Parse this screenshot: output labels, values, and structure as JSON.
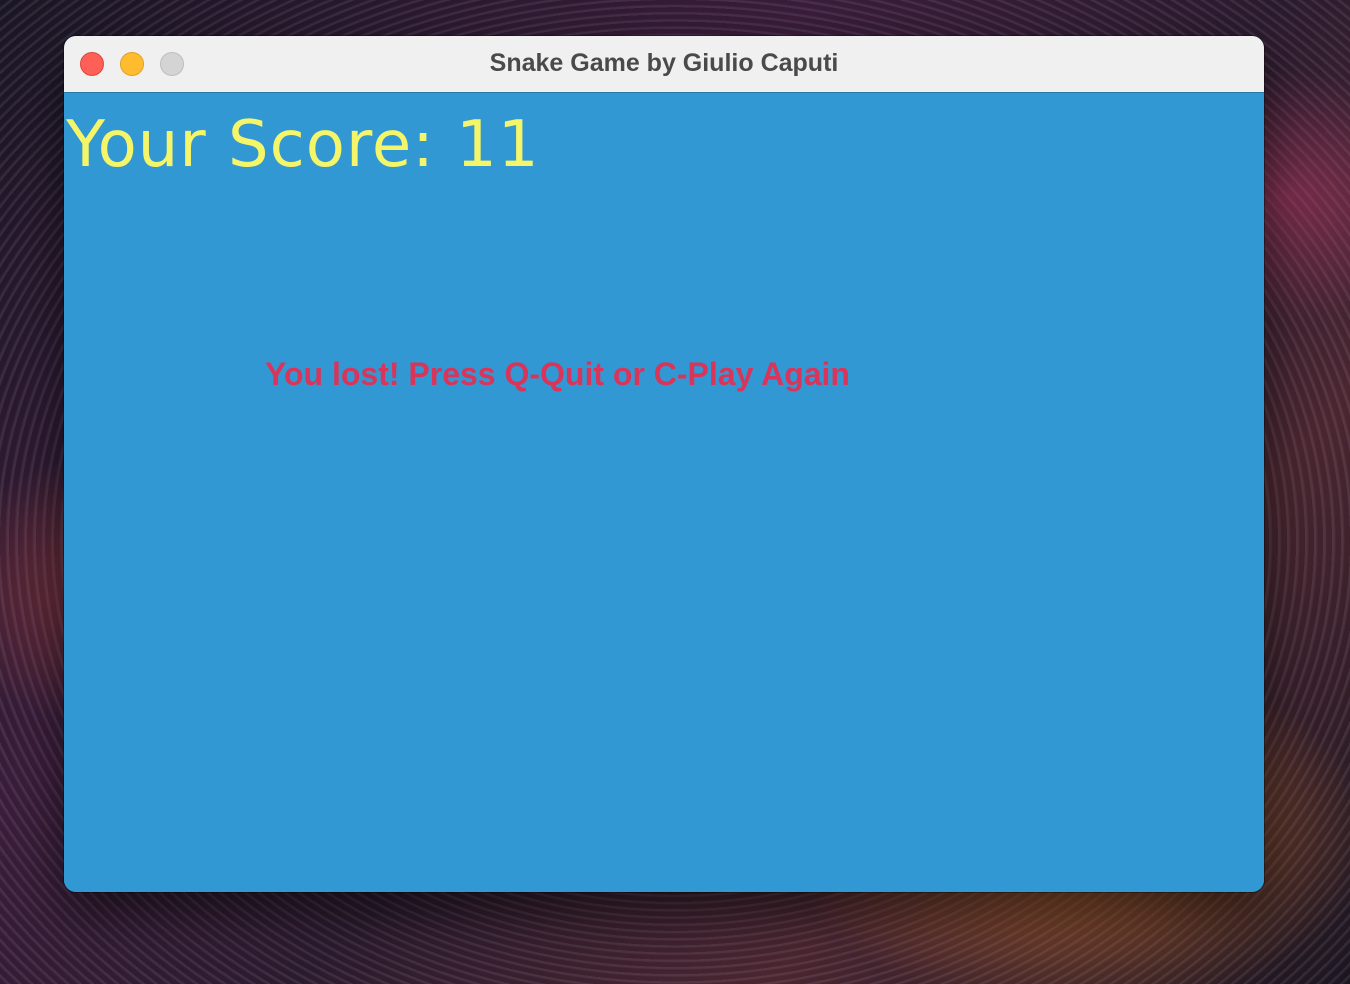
{
  "window": {
    "title": "Snake Game by Giulio Caputi"
  },
  "game": {
    "score_text": "Your Score: 11",
    "game_over_message": "You lost! Press Q-Quit or C-Play Again"
  },
  "colors": {
    "game_background": "#3198d3",
    "score_text": "#f5f56a",
    "message_text": "#d9355a"
  }
}
